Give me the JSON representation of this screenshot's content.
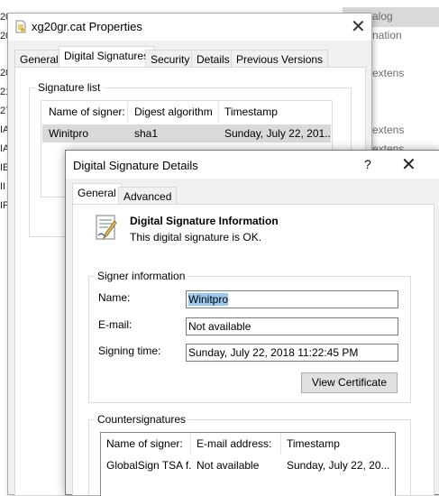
{
  "background": {
    "right_texts": [
      "alog",
      "nation",
      "extens",
      "extens",
      "extens"
    ],
    "left_texts": [
      "20",
      "20",
      "20",
      "21",
      "27",
      "IA",
      "IA",
      "IE",
      "II",
      "IF"
    ]
  },
  "properties": {
    "title": "xg20gr.cat Properties",
    "tabs": [
      "General",
      "Digital Signatures",
      "Security",
      "Details",
      "Previous Versions"
    ],
    "active_tab_index": 1,
    "signature_list_label": "Signature list",
    "columns": [
      "Name of signer:",
      "Digest algorithm",
      "Timestamp"
    ],
    "rows": [
      {
        "signer": "Winitpro",
        "digest": "sha1",
        "timestamp": "Sunday, July 22, 201..."
      }
    ]
  },
  "details": {
    "title": "Digital Signature Details",
    "help_label": "?",
    "tabs": [
      "General",
      "Advanced"
    ],
    "active_tab_index": 0,
    "info_heading": "Digital Signature Information",
    "info_text": "This digital signature is OK.",
    "signer_group_label": "Signer information",
    "name_label": "Name:",
    "name_value": "Winitpro",
    "email_label": "E-mail:",
    "email_value": "Not available",
    "signing_time_label": "Signing time:",
    "signing_time_value": "Sunday, July 22, 2018 11:22:45 PM",
    "view_certificate_label": "View Certificate",
    "counter_group_label": "Countersignatures",
    "counter_columns": [
      "Name of signer:",
      "E-mail address:",
      "Timestamp"
    ],
    "counter_rows": [
      {
        "signer": "GlobalSign TSA f...",
        "email": "Not available",
        "timestamp": "Sunday, July 22, 20..."
      }
    ]
  },
  "colors": {
    "dialog_bg": "#f0f0f0",
    "selection": "#99c9ef",
    "row_highlight": "#d9d9d9"
  }
}
